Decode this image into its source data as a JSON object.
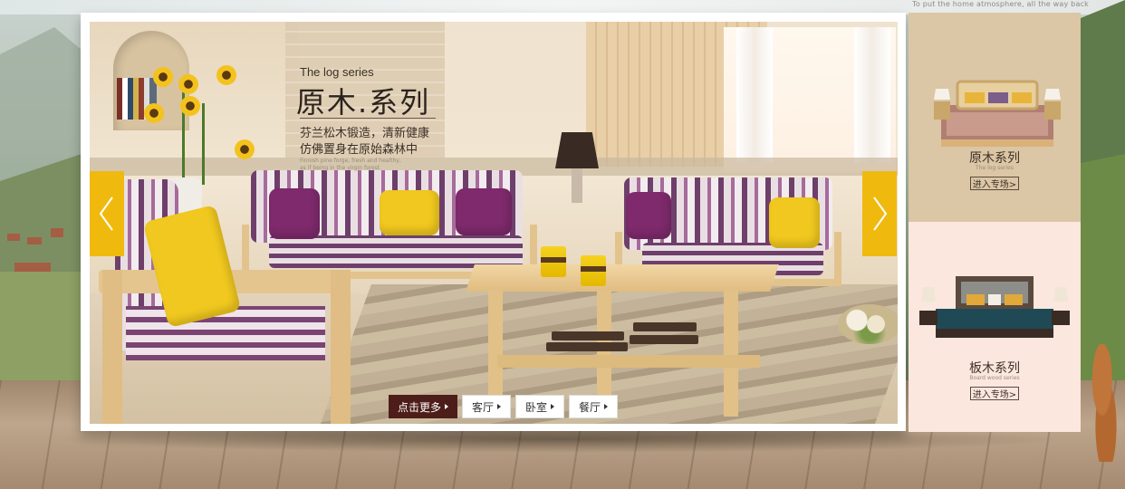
{
  "header": {
    "top_tagline": "To put the home atmosphere, all the way back"
  },
  "banner": {
    "en_title": "The log series",
    "cn_title": "原木.系列",
    "desc_line1": "芬兰松木锻造，清新健康",
    "desc_line2": "仿佛置身在原始森林中",
    "tiny_text": "Finnish pine forge, fresh and healthy, as if being in the virgin forest",
    "buttons": [
      {
        "label": "点击更多"
      },
      {
        "label": "客厅"
      },
      {
        "label": "卧室"
      },
      {
        "label": "餐厅"
      }
    ],
    "prev_icon": "chevron-left-icon",
    "next_icon": "chevron-right-icon"
  },
  "sidebar": {
    "panels": [
      {
        "title": "原木系列",
        "subtitle": "The log series",
        "button": "进入专场>"
      },
      {
        "title": "板木系列",
        "subtitle": "Board wood series",
        "button": "进入专场>"
      }
    ]
  },
  "colors": {
    "accent_yellow": "#f0b90e",
    "dark_button": "#4d1d19",
    "panel_tan": "#dbc6a5",
    "panel_pink": "#fbe7de"
  }
}
